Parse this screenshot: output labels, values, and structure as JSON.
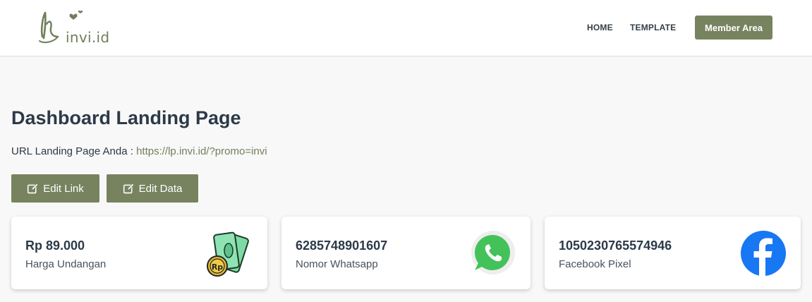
{
  "header": {
    "logo_text": "invi.id",
    "nav": {
      "home": "HOME",
      "template": "TEMPLATE",
      "member_area": "Member Area"
    }
  },
  "main": {
    "title": "Dashboard Landing Page",
    "url_label": "URL Landing Page Anda : ",
    "url_value": "https://lp.invi.id/?promo=invi",
    "buttons": {
      "edit_link": "Edit Link",
      "edit_data": "Edit Data"
    },
    "cards": [
      {
        "value": "Rp 89.000",
        "label": "Harga Undangan",
        "icon": "money-icon"
      },
      {
        "value": "6285748901607",
        "label": "Nomor Whatsapp",
        "icon": "whatsapp-icon"
      },
      {
        "value": "1050230765574946",
        "label": "Facebook Pixel",
        "icon": "facebook-icon"
      }
    ]
  },
  "colors": {
    "accent": "#77835f",
    "url_text": "#717f5b",
    "heading": "#2c3a48",
    "whatsapp": "#43c25a",
    "facebook": "#1877f2"
  }
}
